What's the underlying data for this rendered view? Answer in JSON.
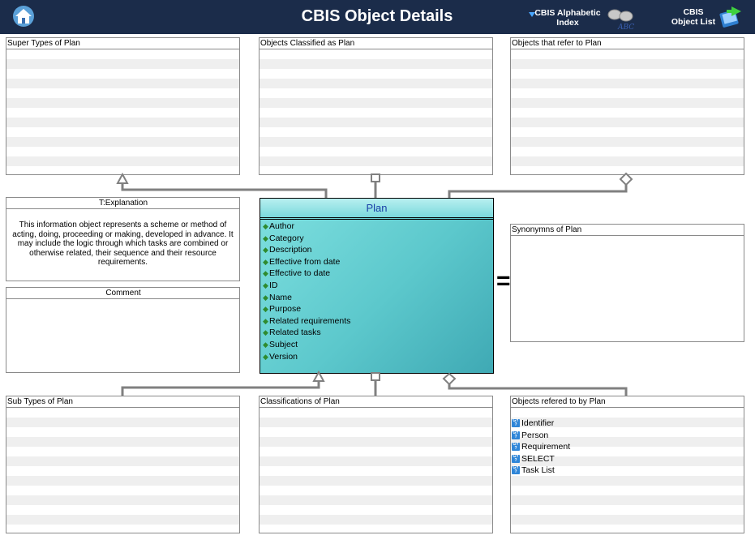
{
  "header": {
    "title": "CBIS Object Details",
    "alpha_index_label_1": "CBIS Alphabetic",
    "alpha_index_label_2": "Index",
    "alpha_index_badge": "ABC",
    "object_list_label_1": "CBIS",
    "object_list_label_2": "Object List",
    "bg_color": "#1b2c4a"
  },
  "panels": {
    "super_types": "Super Types of Plan",
    "classified_as": "Objects Classified as  Plan",
    "refer_to": "Objects that refer to   Plan",
    "explanation": "T:Explanation",
    "comment": "Comment",
    "synonyms": "Synonymns  of Plan",
    "sub_types": "Sub Types of Plan",
    "classifications": "Classifications of Plan",
    "refered_by": "Objects refered to by   Plan"
  },
  "explanation_text": "This information object represents a scheme or method of acting, doing, proceeding or making, developed in advance. It may include the logic through which tasks are combined or otherwise related, their sequence and their resource requirements.",
  "plan": {
    "name": "Plan",
    "attributes": [
      "Author",
      "Category",
      "Description",
      "Effective from date",
      "Effective to date",
      "ID",
      "Name",
      "Purpose",
      "Related requirements",
      "Related tasks",
      "Subject",
      "Version"
    ]
  },
  "equals_symbol": "=",
  "refered_by_items": [
    "Identifier",
    "Person",
    "Requirement",
    "SELECT",
    "Task List"
  ],
  "icon_text": {
    "ref_icon": "GY\n?"
  },
  "colors": {
    "plan_fill": "#5cc8cc",
    "plan_title_text": "#1a3fa8",
    "connector": "#808080",
    "ref_icon": "#2f86d8"
  },
  "icons": {
    "home": "house-icon",
    "alpha_index": "binoculars-icon",
    "object_list": "book-arrow-icon",
    "attribute": "green-diamond-icon",
    "reference": "query-icon"
  }
}
